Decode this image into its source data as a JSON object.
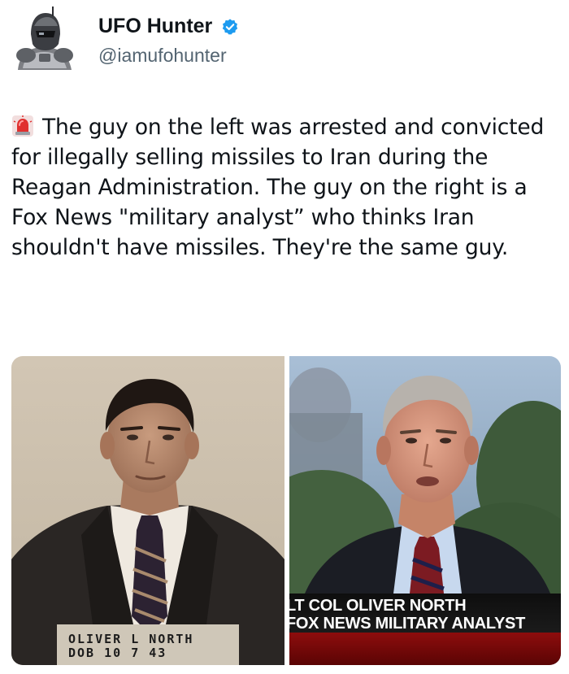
{
  "author": {
    "display_name": "UFO Hunter",
    "handle": "@iamufohunter",
    "verified": true,
    "avatar_icon": "robot-soldier-avatar",
    "verified_icon": "verified-badge-icon",
    "verified_color": "#1d9bf0"
  },
  "tweet": {
    "emoji_icon": "police-light-icon",
    "text": "The guy on the left was arrested and convicted for illegally selling missiles to Iran during the Reagan Administration. The guy on the right is a Fox News \"military analyst” who thinks Iran shouldn't have missiles. They're the same guy."
  },
  "media": {
    "left_caption_line1": "OLIVER L NORTH",
    "left_caption_line2": "DOB 10 7 43",
    "right_chyron_line1": "LT COL OLIVER NORTH",
    "right_chyron_line2": "FOX NEWS MILITARY ANALYST"
  }
}
